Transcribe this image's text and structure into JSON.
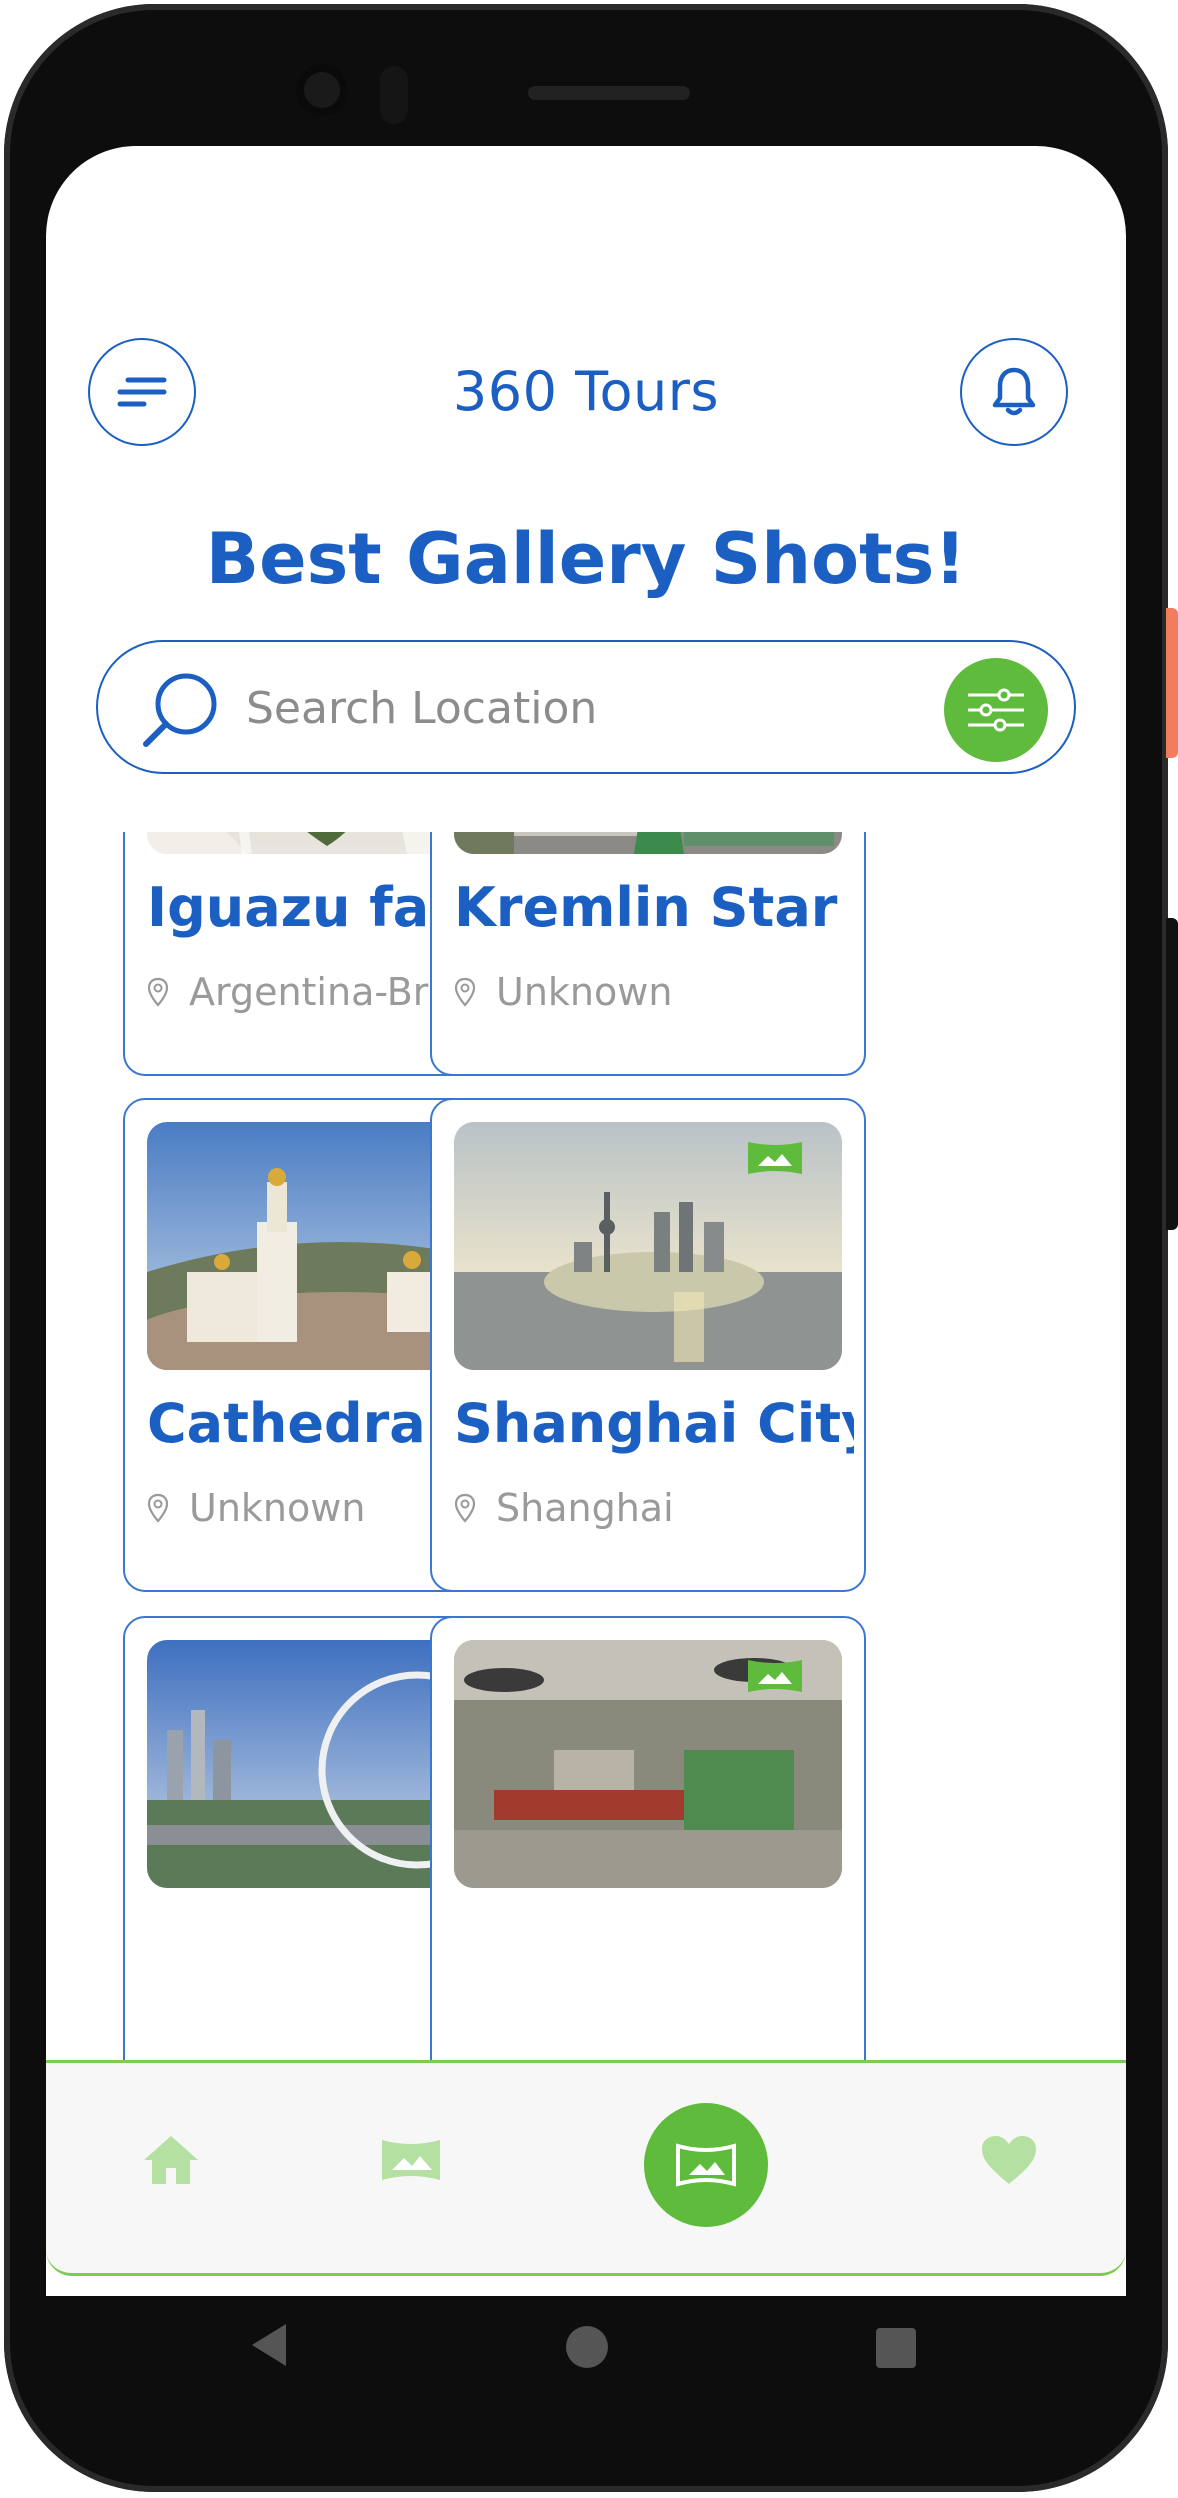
{
  "header": {
    "app_title": "360 Tours",
    "headline": "Best Gallery Shots!"
  },
  "search": {
    "placeholder": "Search Location"
  },
  "cards": [
    {
      "title": "Iguazu falls",
      "location": "Argentina-Brazil",
      "image": "waterfall-aerial"
    },
    {
      "title": "Kremlin Star",
      "location": "Unknown",
      "image": "kremlin-aerial"
    },
    {
      "title": "Cathedral ...",
      "location": "Unknown",
      "image": "cathedral-panorama"
    },
    {
      "title": "Shanghai City",
      "location": "Shanghai",
      "image": "shanghai-skyline"
    },
    {
      "title": "",
      "location": "",
      "image": "singapore-ferris-wheel"
    },
    {
      "title": "",
      "location": "",
      "image": "red-square-helicopters"
    }
  ],
  "bottom_nav": {
    "items": [
      "home-icon",
      "gallery-icon",
      "panorama-icon",
      "heart-icon"
    ],
    "active": "panorama-icon"
  },
  "colors": {
    "primary": "#1b5fc3",
    "accent": "#5fbb3c",
    "nav_inactive": "#b4e0a2",
    "muted": "#9a9a9a"
  }
}
